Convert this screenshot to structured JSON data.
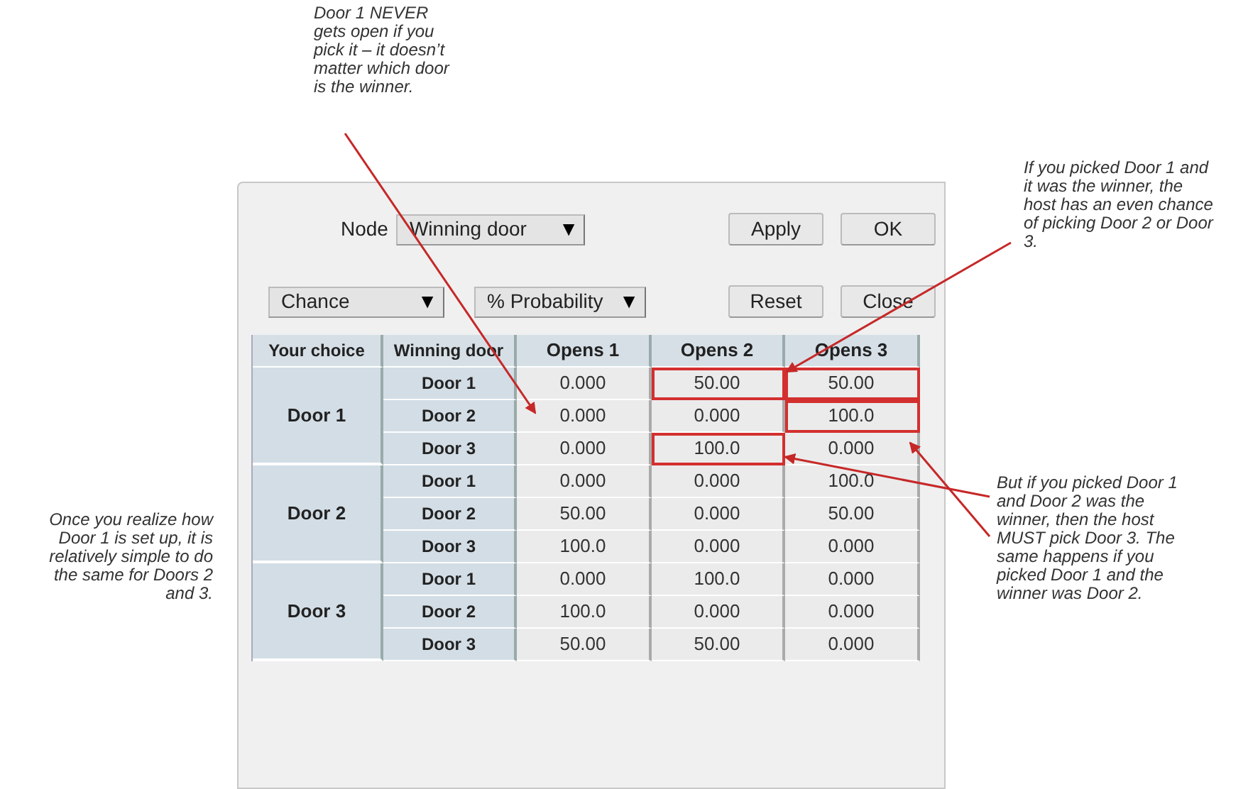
{
  "callouts": [
    {
      "kind": "top",
      "text": "Door 1 NEVER gets open if you pick it – it doesn’t matter which door is the winner."
    },
    {
      "kind": "right-top",
      "text": "If you picked Door 1 and it was the winner, the host has an even chance of picking Door 2 or Door 3."
    },
    {
      "kind": "left",
      "text": "Once you realize how Door 1 is set up, it is relatively simple to do the same for Doors 2 and 3."
    },
    {
      "kind": "right-bottom",
      "text": "But if you picked Door 1 and Door 2 was the winner, then the host MUST pick Door 3. The same happens if you picked Door 1 and the winner was Door 2."
    }
  ],
  "node": {
    "label": "Node",
    "dropdown": {
      "value": "Winning door",
      "arrow": "▼"
    }
  },
  "selectors": [
    {
      "value": "Chance",
      "arrow": "▼"
    },
    {
      "value": "% Probability",
      "arrow": "▼"
    }
  ],
  "buttons_top": [
    "Apply",
    "OK"
  ],
  "buttons_bottom": [
    "Reset",
    "Close"
  ],
  "table": {
    "columns": [
      "Your choice",
      "Winning door",
      "Opens 1",
      "Opens 2",
      "Opens 3"
    ],
    "groups": [
      {
        "choice": "Door 1",
        "rows": [
          {
            "winning": "Door 1",
            "cells": [
              {
                "value": "0.000",
                "highlighted": false
              },
              {
                "value": "50.00",
                "highlighted": true
              },
              {
                "value": "50.00",
                "highlighted": true
              }
            ]
          },
          {
            "winning": "Door 2",
            "cells": [
              {
                "value": "0.000",
                "highlighted": false
              },
              {
                "value": "0.000",
                "highlighted": false
              },
              {
                "value": "100.0",
                "highlighted": true
              }
            ]
          },
          {
            "winning": "Door 3",
            "cells": [
              {
                "value": "0.000",
                "highlighted": false
              },
              {
                "value": "100.0",
                "highlighted": true
              },
              {
                "value": "0.000",
                "highlighted": false
              }
            ]
          }
        ]
      },
      {
        "choice": "Door 2",
        "rows": [
          {
            "winning": "Door 1",
            "cells": [
              {
                "value": "0.000",
                "highlighted": false
              },
              {
                "value": "0.000",
                "highlighted": false
              },
              {
                "value": "100.0",
                "highlighted": false
              }
            ]
          },
          {
            "winning": "Door 2",
            "cells": [
              {
                "value": "50.00",
                "highlighted": false
              },
              {
                "value": "0.000",
                "highlighted": false
              },
              {
                "value": "50.00",
                "highlighted": false
              }
            ]
          },
          {
            "winning": "Door 3",
            "cells": [
              {
                "value": "100.0",
                "highlighted": false
              },
              {
                "value": "0.000",
                "highlighted": false
              },
              {
                "value": "0.000",
                "highlighted": false
              }
            ]
          }
        ]
      },
      {
        "choice": "Door 3",
        "rows": [
          {
            "winning": "Door 1",
            "cells": [
              {
                "value": "0.000",
                "highlighted": false
              },
              {
                "value": "100.0",
                "highlighted": false
              },
              {
                "value": "0.000",
                "highlighted": false
              }
            ]
          },
          {
            "winning": "Door 2",
            "cells": [
              {
                "value": "100.0",
                "highlighted": false
              },
              {
                "value": "0.000",
                "highlighted": false
              },
              {
                "value": "0.000",
                "highlighted": false
              }
            ]
          },
          {
            "winning": "Door 3",
            "cells": [
              {
                "value": "50.00",
                "highlighted": false
              },
              {
                "value": "50.00",
                "highlighted": false
              },
              {
                "value": "0.000",
                "highlighted": false
              }
            ]
          }
        ]
      }
    ]
  }
}
